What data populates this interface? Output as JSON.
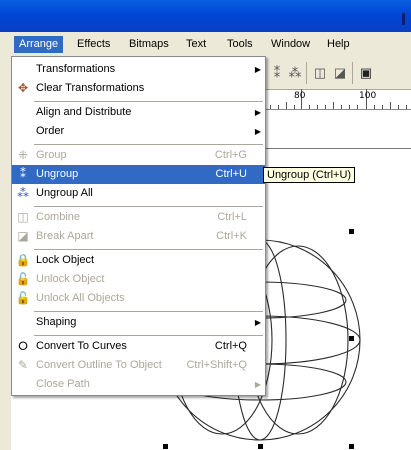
{
  "menubar": {
    "items": [
      {
        "label": "Arrange",
        "active": true
      },
      {
        "label": "Effects"
      },
      {
        "label": "Bitmaps"
      },
      {
        "label": "Text"
      },
      {
        "label": "Tools"
      },
      {
        "label": "Window"
      },
      {
        "label": "Help"
      }
    ]
  },
  "ruler": {
    "labels": [
      "80",
      "100"
    ]
  },
  "arrange_menu": {
    "items": [
      {
        "label": "Transformations",
        "submenu": true
      },
      {
        "label": "Clear Transformations"
      },
      {
        "label": "Align and Distribute",
        "submenu": true
      },
      {
        "label": "Order",
        "submenu": true
      },
      {
        "label": "Group",
        "shortcut": "Ctrl+G",
        "disabled": true
      },
      {
        "label": "Ungroup",
        "shortcut": "Ctrl+U",
        "highlighted": true
      },
      {
        "label": "Ungroup All"
      },
      {
        "label": "Combine",
        "shortcut": "Ctrl+L",
        "disabled": true
      },
      {
        "label": "Break  Apart",
        "shortcut": "Ctrl+K",
        "disabled": true
      },
      {
        "label": "Lock Object"
      },
      {
        "label": "Unlock Object",
        "disabled": true
      },
      {
        "label": "Unlock All Objects",
        "disabled": true
      },
      {
        "label": "Shaping",
        "submenu": true
      },
      {
        "label": "Convert To Curves",
        "shortcut": "Ctrl+Q"
      },
      {
        "label": "Convert Outline To Object",
        "shortcut": "Ctrl+Shift+Q",
        "disabled": true
      },
      {
        "label": "Close Path",
        "submenu": true,
        "disabled": true
      }
    ]
  },
  "tooltip": {
    "text": "Ungroup (Ctrl+U)"
  },
  "colors": {
    "highlight": "#316ac5",
    "menubar": "#ece9d8",
    "titlebar": "#0046d5",
    "disabled": "#aca899",
    "tooltip_bg": "#ffffe1"
  }
}
